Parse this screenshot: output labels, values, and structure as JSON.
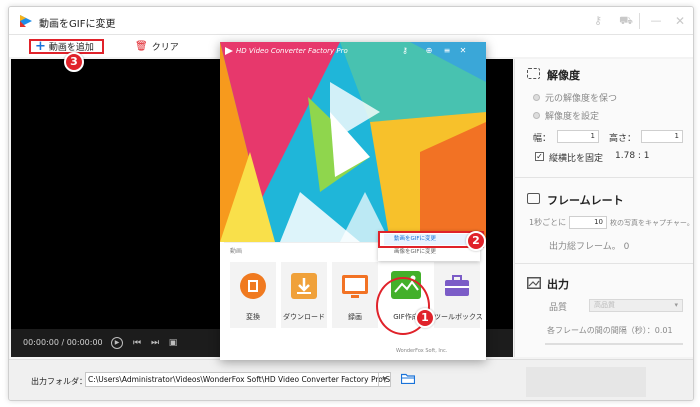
{
  "window": {
    "title": "動画をGIFに変更"
  },
  "toolbar": {
    "add_label": "動画を追加",
    "clear_label": "クリア"
  },
  "player": {
    "timecode": "00:00:00  /  00:00:00"
  },
  "settings": {
    "resolution_title": "解像度",
    "keep_original": "元の解像度を保つ",
    "set_resolution": "解像度を設定",
    "width_label": "幅：",
    "width_value": "1",
    "height_label": "高さ：",
    "height_value": "1",
    "keep_ratio_label": "縦横比を固定",
    "ratio_value": "1.78 : 1",
    "framerate_title": "フレームレート",
    "per_second_prefix": "1秒ごとに",
    "per_second_value": "10",
    "per_second_suffix": "枚の写真をキャプチャー。",
    "output_frames": "出力総フレーム。   0",
    "output_title": "出力",
    "quality_label": "品質",
    "quality_value": "高品質",
    "interval_label": "各フレームの間の間隔（秒）：0.01"
  },
  "bottom": {
    "output_folder_label": "出力フォルダ：",
    "output_path": "C:\\Users\\Administrator\\Videos\\WonderFox Soft\\HD Video Converter Factory Pro\\SaveImage\\"
  },
  "overlay": {
    "title": "HD Video Converter Factory Pro",
    "recent_label": "動画",
    "tiles": [
      {
        "label": "変換",
        "color": "#f07a20"
      },
      {
        "label": "ダウンロード",
        "color": "#f0a13a"
      },
      {
        "label": "録画",
        "color": "#f27224"
      },
      {
        "label": "GIF作成",
        "color": "#43b02a"
      },
      {
        "label": "ツールボックス",
        "color": "#7b5cc7"
      }
    ],
    "menu_items": [
      "動画をGIFに変更",
      "画像をGIFに変更"
    ],
    "footer": "WonderFox Soft, Inc."
  },
  "annotations": {
    "badge_1": "1",
    "badge_2": "2",
    "badge_3": "3",
    "color": "#e0222a"
  }
}
